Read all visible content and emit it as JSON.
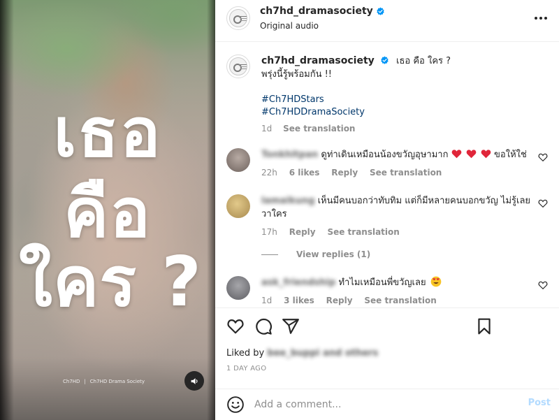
{
  "media": {
    "overlay_lines": [
      "เธอ",
      "คือ",
      "ใคร ?"
    ],
    "credit_left": "Ch7HD",
    "credit_right": "Ch7HD Drama Society",
    "mute_icon": "speaker-icon"
  },
  "header": {
    "username": "ch7hd_dramasociety",
    "subtitle": "Original audio"
  },
  "caption": {
    "username": "ch7hd_dramasociety",
    "line1": "เธอ คือ ใคร ?",
    "line2": "พรุ่งนี้รู้พร้อมกัน !!",
    "hashtags": [
      "#Ch7HDStars",
      "#Ch7HDDramaSociety"
    ],
    "time": "1d",
    "see_translation": "See translation"
  },
  "comments": [
    {
      "username": "Tonkhitpan",
      "text": "ดูท่าเดินเหมือนน้องขวัญอุษามาก",
      "text_after_hearts": "ขอให้ใช่",
      "time": "22h",
      "likes": "6 likes",
      "reply": "Reply",
      "see_translation": "See translation",
      "avatar_color": "#9b8f8a"
    },
    {
      "username": "lamaikung",
      "text": "เห็นมีคนบอกว่าทับทิม แต่ก็มีหลายคนบอกขวัญ ไม่รู้เลย วาใคร",
      "time": "17h",
      "reply": "Reply",
      "see_translation": "See translation",
      "avatar_color": "#c9ae75"
    },
    {
      "username": "ask_friendship",
      "text": "ทำไมเหมือนพี่ขวัญเลย",
      "time": "1d",
      "likes": "3 likes",
      "reply": "Reply",
      "see_translation": "See translation",
      "avatar_color": "#8a8a8d"
    }
  ],
  "view_replies": "View replies (1)",
  "actions": {
    "liked_by_label": "Liked by",
    "liked_by_names": "bee_buppi and others",
    "date": "1 DAY AGO"
  },
  "comment_box": {
    "placeholder": "Add a comment...",
    "post_label": "Post"
  },
  "colors": {
    "verified": "#0095f6",
    "heart": "#ed4956",
    "hashtag": "#00376b",
    "post_disabled": "#b3dbff"
  }
}
